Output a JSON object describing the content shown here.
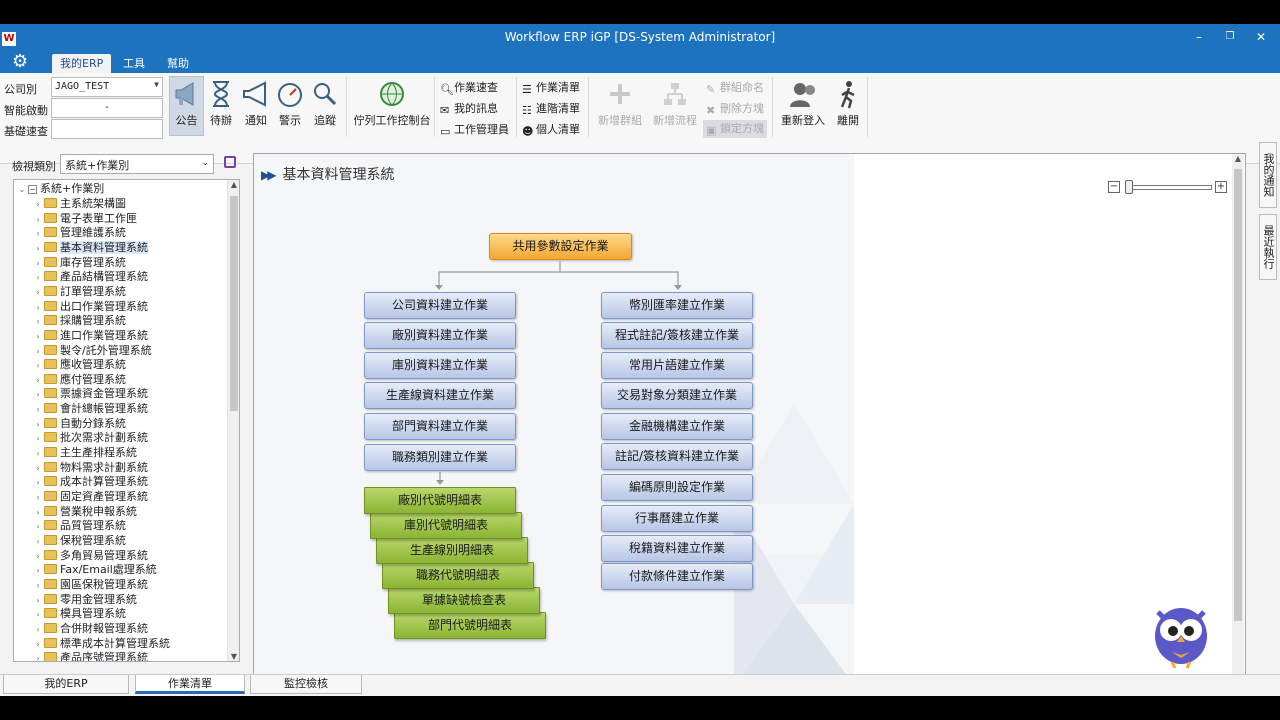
{
  "window": {
    "title": "Workflow ERP iGP [DS-System Administrator]",
    "logo_text": "W",
    "min_glyph": "–",
    "restore_glyph": "❐",
    "close_glyph": "✕"
  },
  "menu": {
    "tabs": [
      "我的ERP",
      "工具",
      "幫助"
    ],
    "active_tab": "我的ERP"
  },
  "ribbon": {
    "fields": {
      "company_label": "公司別",
      "company_value": "JAGO_TEST",
      "smart_start_label": "智能啟動",
      "smart_start_value": "-",
      "quick_query_label": "基礎速查",
      "quick_query_value": ""
    },
    "big_buttons": {
      "announce": "公告",
      "pending": "待辦",
      "notify": "通知",
      "alert": "警示",
      "track": "追蹤",
      "queue_console": "佇列工作控制台",
      "new_group": "新增群組",
      "new_flow": "新增流程",
      "relogin": "重新登入",
      "leave": "離開"
    },
    "small_buttons": {
      "task_search": "作業速查",
      "my_messages": "我的訊息",
      "job_manager": "工作管理員",
      "task_list": "作業清單",
      "advanced_list": "進階清單",
      "personal_list": "個人清單",
      "group_rename": "群組命名",
      "delete_cube": "刪除方塊",
      "lock_cube": "鎖定方塊"
    }
  },
  "left_panel": {
    "view_label": "檢視類別",
    "view_value": "系統+作業別",
    "tree_root": "系統+作業別",
    "tree_items": [
      "主系統架構圖",
      "電子表單工作匣",
      "管理維護系統",
      "基本資料管理系統",
      "庫存管理系統",
      "產品結構管理系統",
      "訂單管理系統",
      "出口作業管理系統",
      "採購管理系統",
      "進口作業管理系統",
      "製令/託外管理系統",
      "應收管理系統",
      "應付管理系統",
      "票據資金管理系統",
      "會計總帳管理系統",
      "自動分錄系統",
      "批次需求計劃系統",
      "主生產排程系統",
      "物料需求計劃系統",
      "成本計算管理系統",
      "固定資產管理系統",
      "營業稅申報系統",
      "品質管理系統",
      "保稅管理系統",
      "多角貿易管理系統",
      "Fax/Email處理系統",
      "園區保稅管理系統",
      "零用金管理系統",
      "模具管理系統",
      "合併財報管理系統",
      "標準成本計算管理系統",
      "產品序號管理系統"
    ],
    "selected_item": "基本資料管理系統"
  },
  "main": {
    "title": "基本資料管理系統",
    "root_node": "共用參數設定作業",
    "left_column": [
      "公司資料建立作業",
      "廠別資料建立作業",
      "庫別資料建立作業",
      "生產線資料建立作業",
      "部門資料建立作業",
      "職務類別建立作業"
    ],
    "reports": [
      "廠別代號明細表",
      "庫別代號明細表",
      "生產線別明細表",
      "職務代號明細表",
      "單據缺號檢查表",
      "部門代號明細表"
    ],
    "right_column": [
      "幣別匯率建立作業",
      "程式註記/簽核建立作業",
      "常用片語建立作業",
      "交易對象分類建立作業",
      "金融機構建立作業",
      "註記/簽核資料建立作業",
      "編碼原則設定作業",
      "行事曆建立作業",
      "稅籍資料建立作業",
      "付款條件建立作業"
    ],
    "zoom_minus": "−",
    "zoom_plus": "+"
  },
  "side_tabs": [
    "我的通知",
    "最近執行"
  ],
  "bottom_tabs": [
    "我的ERP",
    "作業清單",
    "監控檢核"
  ],
  "active_bottom_tab": "作業清單",
  "colors": {
    "titlebar": "#1e73be",
    "node_blue": "#b7c6e6",
    "node_orange": "#f4a731",
    "node_green": "#8ab533",
    "folder": "#e8c15a"
  }
}
